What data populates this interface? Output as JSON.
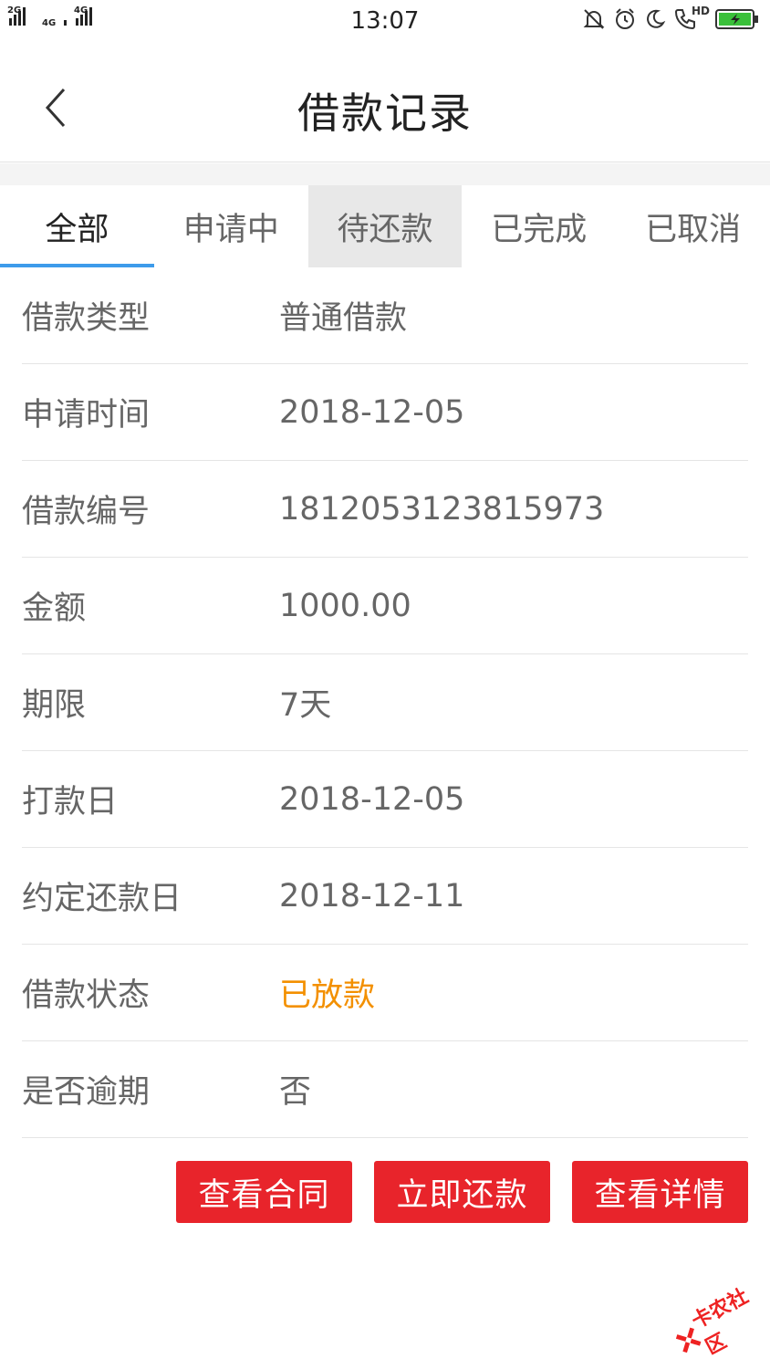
{
  "status_bar": {
    "time": "13:07",
    "network_1": "2G",
    "network_2": "4G",
    "network_3": "4G",
    "call_tag": "HD",
    "battery_color": "#3ac03a"
  },
  "header": {
    "title": "借款记录",
    "back_icon": "chevron-left-icon"
  },
  "tabs": [
    {
      "label": "全部",
      "active": true
    },
    {
      "label": "申请中"
    },
    {
      "label": "待还款",
      "pressed": true
    },
    {
      "label": "已完成"
    },
    {
      "label": "已取消"
    }
  ],
  "details": [
    {
      "label": "借款类型",
      "value": "普通借款"
    },
    {
      "label": "申请时间",
      "value": "2018-12-05"
    },
    {
      "label": "借款编号",
      "value": "1812053123815973"
    },
    {
      "label": "金额",
      "value": "1000.00"
    },
    {
      "label": "期限",
      "value": "7天"
    },
    {
      "label": "打款日",
      "value": "2018-12-05"
    },
    {
      "label": "约定还款日",
      "value": "2018-12-11"
    },
    {
      "label": "借款状态",
      "value": "已放款",
      "color": "#f39000"
    },
    {
      "label": "是否逾期",
      "value": "否"
    }
  ],
  "actions": {
    "view_contract": "查看合同",
    "repay_now": "立即还款",
    "view_details": "查看详情",
    "color": "#e8242b"
  },
  "watermark": {
    "text": "卡农社区"
  },
  "colors": {
    "tab_indicator": "#3d9bea",
    "accent_status": "#f39000"
  }
}
